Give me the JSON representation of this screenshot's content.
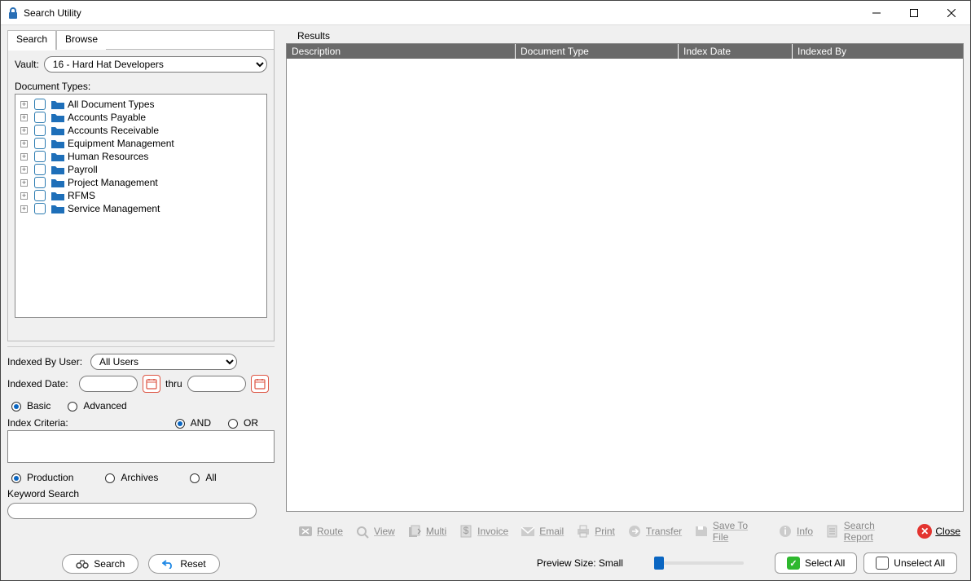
{
  "window": {
    "title": "Search Utility"
  },
  "tabs": {
    "search": "Search",
    "browse": "Browse"
  },
  "vault": {
    "label": "Vault:",
    "value": "16 - Hard Hat Developers"
  },
  "doctypes": {
    "label": "Document Types:",
    "items": [
      "All Document Types",
      "Accounts Payable",
      "Accounts Receivable",
      "Equipment Management",
      "Human Resources",
      "Payroll",
      "Project Management",
      "RFMS",
      "Service Management"
    ]
  },
  "indexed_by": {
    "label": "Indexed By User:",
    "value": "All Users"
  },
  "indexed_date": {
    "label": "Indexed Date:",
    "from": "",
    "thru_label": "thru",
    "to": ""
  },
  "mode": {
    "basic": "Basic",
    "advanced": "Advanced"
  },
  "criteria": {
    "label": "Index Criteria:",
    "and": "AND",
    "or": "OR"
  },
  "scope": {
    "production": "Production",
    "archives": "Archives",
    "all": "All"
  },
  "keyword": {
    "label": "Keyword Search",
    "value": ""
  },
  "buttons": {
    "search": "Search",
    "reset": "Reset"
  },
  "results": {
    "label": "Results",
    "columns": {
      "description": "Description",
      "doc_type": "Document Type",
      "index_date": "Index Date",
      "indexed_by": "Indexed By"
    }
  },
  "toolbar": {
    "route": "Route",
    "view": "View",
    "multi": "Multi",
    "invoice": "Invoice",
    "email": "Email",
    "print": "Print",
    "transfer": "Transfer",
    "save": "Save To File",
    "info": "Info",
    "report": "Search Report",
    "close": "Close"
  },
  "footer": {
    "preview": "Preview Size: Small",
    "select_all": "Select All",
    "unselect_all": "Unselect All"
  }
}
